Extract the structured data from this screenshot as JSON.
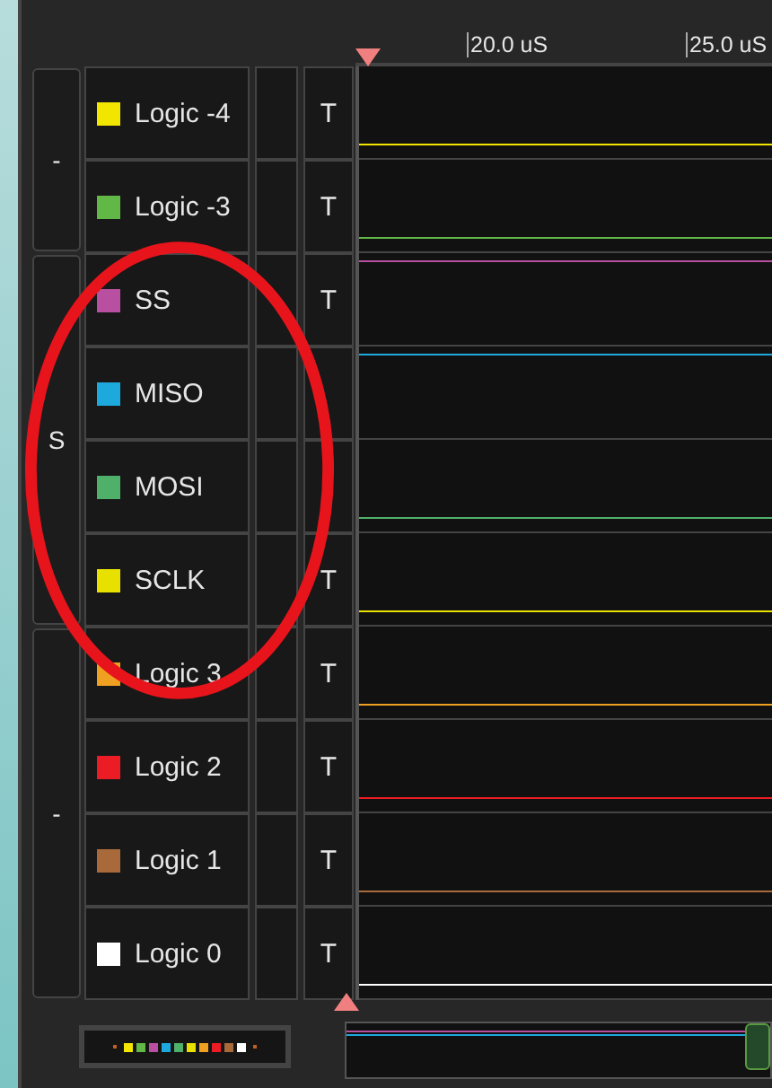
{
  "timeline": {
    "ticks": [
      "20.0 uS",
      "25.0 uS"
    ]
  },
  "groups": [
    {
      "label": "-",
      "channels": [
        {
          "name": "Logic -4",
          "color": "#f2e600",
          "trigger": "T",
          "high": false
        },
        {
          "name": "Logic -3",
          "color": "#62b846",
          "trigger": "T",
          "high": false
        }
      ]
    },
    {
      "label": "S",
      "channels": [
        {
          "name": "SS",
          "color": "#b84fa0",
          "trigger": "T",
          "high": true
        },
        {
          "name": "MISO",
          "color": "#1ea9dc",
          "high": true
        },
        {
          "name": "MOSI",
          "color": "#4fb06a",
          "high": false
        },
        {
          "name": "SCLK",
          "color": "#e8e100",
          "trigger": "T",
          "high": false
        }
      ]
    },
    {
      "label": "-",
      "channels": [
        {
          "name": "Logic 3",
          "color": "#f0a020",
          "trigger": "T",
          "high": false
        },
        {
          "name": "Logic 2",
          "color": "#ec1c24",
          "trigger": "T",
          "high": false
        },
        {
          "name": "Logic 1",
          "color": "#a86a3a",
          "trigger": "T",
          "high": false
        },
        {
          "name": "Logic 0",
          "color": "#ffffff",
          "trigger": "T",
          "high": false
        }
      ]
    }
  ]
}
